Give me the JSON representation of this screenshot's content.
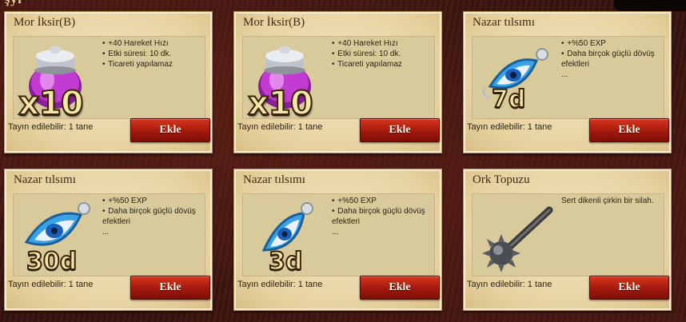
{
  "header": {
    "fragment": "şyı"
  },
  "cards": [
    {
      "title": "Mor İksir(B)",
      "badge": "x10",
      "icon": "purple-potion-icon",
      "desc": [
        "+40 Hareket Hızı",
        "Etki süresi: 10 dk.",
        "Ticareti yapılamaz"
      ],
      "footer_label": "Tayın edilebilir:",
      "footer_value": "1 tane",
      "button": "Ekle"
    },
    {
      "title": "Mor İksir(B)",
      "badge": "x10",
      "icon": "purple-potion-icon",
      "desc": [
        "+40 Hareket Hızı",
        "Etki süresi: 10 dk.",
        "Ticareti yapılamaz"
      ],
      "footer_label": "Tayın edilebilir:",
      "footer_value": "1 tane",
      "button": "Ekle"
    },
    {
      "title": "Nazar tılsımı",
      "badge": "7d",
      "icon": "evil-eye-amulet-icon",
      "desc": [
        "+%50 EXP",
        "Daha birçok güçlü dövüş efektleri",
        "..."
      ],
      "footer_label": "Tayın edilebilir:",
      "footer_value": "1 tane",
      "button": "Ekle"
    },
    {
      "title": "Nazar tılsımı",
      "badge": "30d",
      "icon": "evil-eye-amulet-icon",
      "desc": [
        "+%50 EXP",
        "Daha birçok güçlü dövüş efektleri",
        "..."
      ],
      "footer_label": "Tayın edilebilir:",
      "footer_value": "1 tane",
      "button": "Ekle"
    },
    {
      "title": "Nazar tılsımı",
      "badge": "3d",
      "icon": "evil-eye-amulet-icon",
      "desc": [
        "+%50 EXP",
        "Daha birçok güçlü dövüş efektleri",
        "..."
      ],
      "footer_label": "Tayın edilebilir:",
      "footer_value": "1 tane",
      "button": "Ekle"
    },
    {
      "title": "Ork Topuzu",
      "badge": "",
      "icon": "spiked-mace-icon",
      "plain_desc": "Sert dikenli çirkin bir silah.",
      "footer_label": "Tayın edilebilir:",
      "footer_value": "1 tane",
      "button": "Ekle"
    }
  ]
}
